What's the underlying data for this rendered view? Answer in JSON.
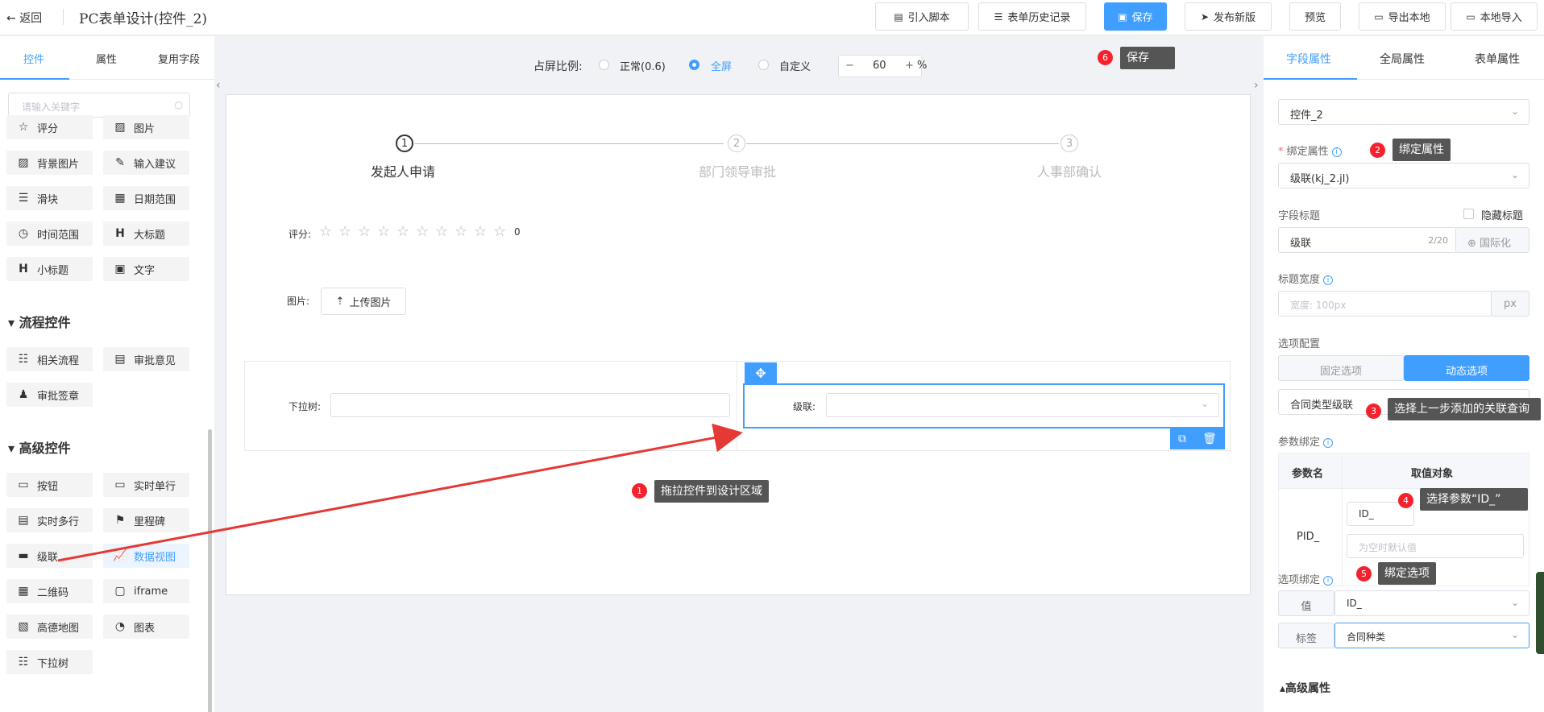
{
  "header": {
    "back_label": "返回",
    "title": "PC表单设计(控件_2)",
    "buttons": {
      "script": "引入脚本",
      "history": "表单历史记录",
      "save": "保存",
      "publish": "发布新版",
      "preview": "预览",
      "export": "导出本地",
      "import": "本地导入"
    }
  },
  "left": {
    "tabs": [
      "控件",
      "属性",
      "复用字段"
    ],
    "search_placeholder": "请输入关键字",
    "basic_items": [
      "评分",
      "图片",
      "背景图片",
      "输入建议",
      "滑块",
      "日期范围",
      "时间范围",
      "大标题",
      "小标题",
      "文字"
    ],
    "flow_title": "流程控件",
    "flow_items": [
      "相关流程",
      "审批意见",
      "审批签章"
    ],
    "adv_title": "高级控件",
    "adv_items": [
      "按钮",
      "实时单行",
      "实时多行",
      "里程碑",
      "级联",
      "数据视图",
      "二维码",
      "iframe",
      "高德地图",
      "图表",
      "下拉树"
    ]
  },
  "center": {
    "ratio_label": "占屏比例:",
    "ratio_options": [
      "正常(0.6)",
      "全屏",
      "自定义"
    ],
    "ratio_selected": "全屏",
    "zoom_value": "60",
    "zoom_unit": "%",
    "minus": "−",
    "plus": "+",
    "steps": [
      {
        "num": "1",
        "label": "发起人申请"
      },
      {
        "num": "2",
        "label": "部门领导审批"
      },
      {
        "num": "3",
        "label": "人事部确认"
      }
    ],
    "rating_label": "评分:",
    "rating_value": "0",
    "image_label": "图片:",
    "upload_label": "上传图片",
    "dropdown_tree_label": "下拉树:",
    "cascade_label": "级联:"
  },
  "annotations": [
    {
      "num": "1",
      "text": "拖拉控件到设计区域"
    },
    {
      "num": "2",
      "text": "绑定属性"
    },
    {
      "num": "3",
      "text": "选择上一步添加的关联查询"
    },
    {
      "num": "4",
      "text": "选择参数“ID_”"
    },
    {
      "num": "5",
      "text": "绑定选项"
    },
    {
      "num": "6",
      "text": "保存"
    }
  ],
  "right": {
    "tabs": [
      "字段属性",
      "全局属性",
      "表单属性"
    ],
    "control_select": "控件_2",
    "bind_label": "绑定属性",
    "bind_value": "级联(kj_2.jl)",
    "field_title_label": "字段标题",
    "hide_title_label": "隐藏标题",
    "field_title_value": "级联",
    "field_title_count": "2/20",
    "i18n_label": "国际化",
    "title_width_label": "标题宽度",
    "title_width_placeholder": "宽度: 100px",
    "title_width_unit": "px",
    "option_config_label": "选项配置",
    "fixed_option": "固定选项",
    "dynamic_option": "动态选项",
    "query_value": "合同类型级联",
    "param_bind_label": "参数绑定",
    "param_name_header": "参数名",
    "param_value_header": "取值对象",
    "param_name": "PID_",
    "param_value": "ID_",
    "param_default_placeholder": "为空时默认值",
    "option_bind_label": "选项绑定",
    "value_label": "值",
    "value_select": "ID_",
    "tag_label": "标签",
    "tag_select": "合同种类",
    "advanced_label": "高级属性"
  }
}
